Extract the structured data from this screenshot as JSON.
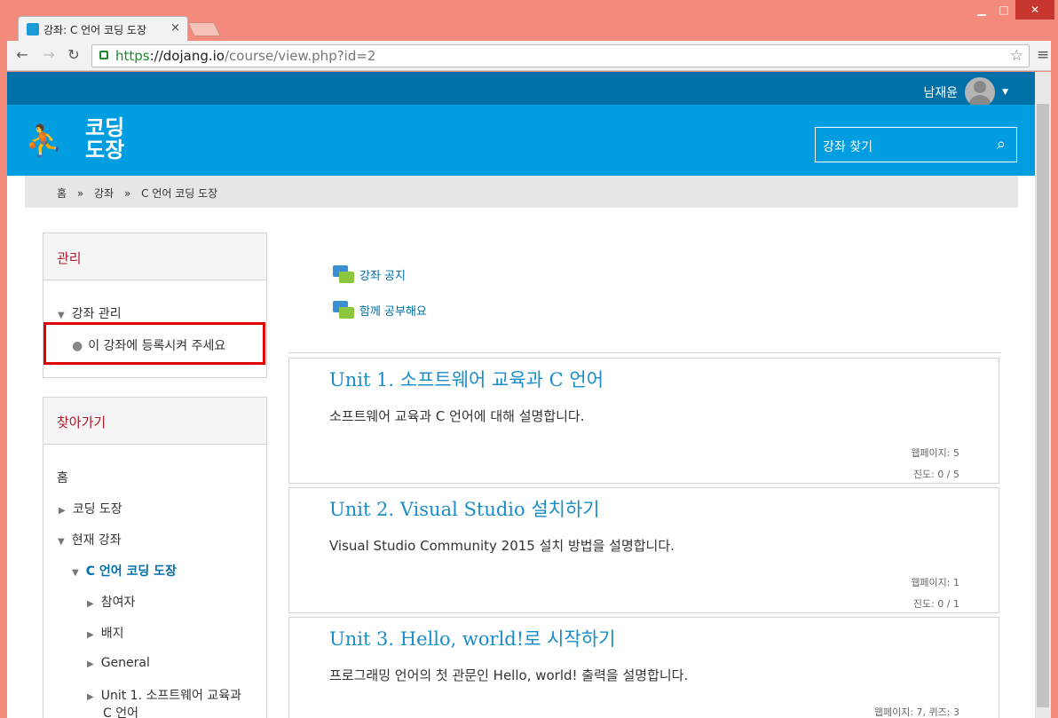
{
  "browser": {
    "tab_title": "강좌: C 언어 코딩 도장",
    "tab_close": "×",
    "url_scheme": "https",
    "url_host": "://dojang.io",
    "url_path": "/course/view.php?id=2",
    "back": "←",
    "forward": "→",
    "reload": "↻",
    "star": "☆",
    "menu": "≡",
    "minimize": "▁",
    "maximize": "□",
    "close": "✕"
  },
  "site": {
    "user_name": "남재윤",
    "logo_line1": "코딩",
    "logo_line2": "도장",
    "logo_icon": "person-figures-icon",
    "search_placeholder": "강좌 찾기",
    "search_icon": "⌕"
  },
  "breadcrumb": {
    "items": [
      "홈",
      "C 언어 코딩 도장"
    ],
    "middle": "강좌",
    "sep": "»"
  },
  "admin_block": {
    "title": "관리",
    "course_admin": "강좌 관리",
    "enroll": "이 강좌에 등록시켜 주세요"
  },
  "nav_block": {
    "title": "찾아가기",
    "home": "홈",
    "coding_dojang": "코딩 도장",
    "current_course": "현재 강좌",
    "course": "C 언어 코딩 도장",
    "participants": "참여자",
    "badges": "배지",
    "general": "General",
    "unit1_line1": "Unit 1. 소프트웨어 교육과",
    "unit1_line2": "C 언어"
  },
  "forums": [
    {
      "label": "강좌 공지"
    },
    {
      "label": "함께 공부해요"
    }
  ],
  "units": [
    {
      "title": "Unit 1. 소프트웨어 교육과 C 언어",
      "desc": "소프트웨어 교육과 C 언어에 대해 설명합니다.",
      "stat1": "웹페이지: 5",
      "stat2": "진도: 0 / 5"
    },
    {
      "title": "Unit 2. Visual Studio 설치하기",
      "desc": "Visual Studio Community 2015 설치 방법을 설명합니다.",
      "stat1": "웹페이지: 1",
      "stat2": "진도: 0 / 1"
    },
    {
      "title": "Unit 3. Hello, world!로 시작하기",
      "desc": "프로그래밍 언어의 첫 관문인 Hello, world! 출력을 설명합니다.",
      "stat1": "웹페이지: 7, 퀴즈: 3",
      "stat2": ""
    }
  ]
}
